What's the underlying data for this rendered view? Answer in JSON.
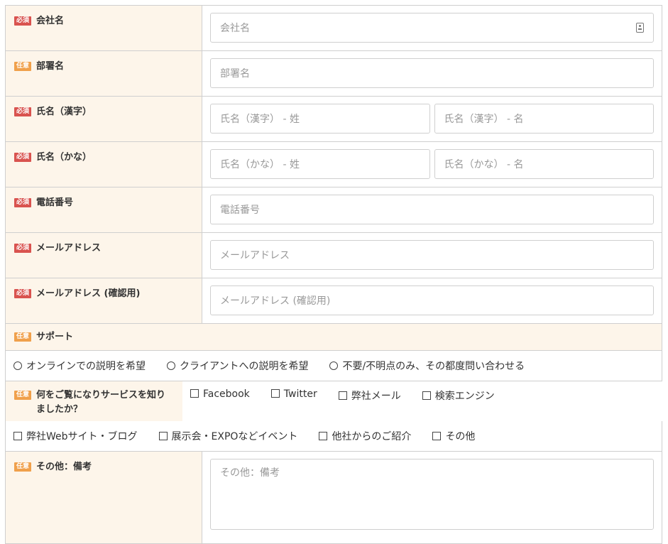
{
  "badges": {
    "required": "必須",
    "optional": "任意"
  },
  "fields": {
    "company": {
      "label": "会社名",
      "placeholder": "会社名"
    },
    "department": {
      "label": "部署名",
      "placeholder": "部署名"
    },
    "name_kanji": {
      "label": "氏名（漢字）",
      "placeholder_last": "氏名（漢字） - 姓",
      "placeholder_first": "氏名（漢字） - 名"
    },
    "name_kana": {
      "label": "氏名（かな）",
      "placeholder_last": "氏名（かな） - 姓",
      "placeholder_first": "氏名（かな） - 名"
    },
    "phone": {
      "label": "電話番号",
      "placeholder": "電話番号"
    },
    "email": {
      "label": "メールアドレス",
      "placeholder": "メールアドレス"
    },
    "email_confirm": {
      "label": "メールアドレス (確認用)",
      "placeholder": "メールアドレス (確認用)"
    }
  },
  "support": {
    "label": "サポート",
    "options": [
      "オンラインでの説明を希望",
      "クライアントへの説明を希望",
      "不要/不明点のみ、その都度問い合わせる"
    ]
  },
  "source": {
    "label": "何をご覧になりサービスを知りましたか？",
    "options_row1": [
      "Facebook",
      "Twitter",
      "弊社メール",
      "検索エンジン"
    ],
    "options_row2": [
      "弊社Webサイト・ブログ",
      "展示会・EXPOなどイベント",
      "他社からのご紹介",
      "その他"
    ]
  },
  "notes": {
    "label": "その他：備考",
    "placeholder": "その他：備考"
  },
  "colors": {
    "required_badge": "#d9534f",
    "optional_badge": "#f0a04b",
    "label_bg": "#fdf5ea"
  },
  "icons": {
    "company_autofill": "contact-card-icon"
  }
}
